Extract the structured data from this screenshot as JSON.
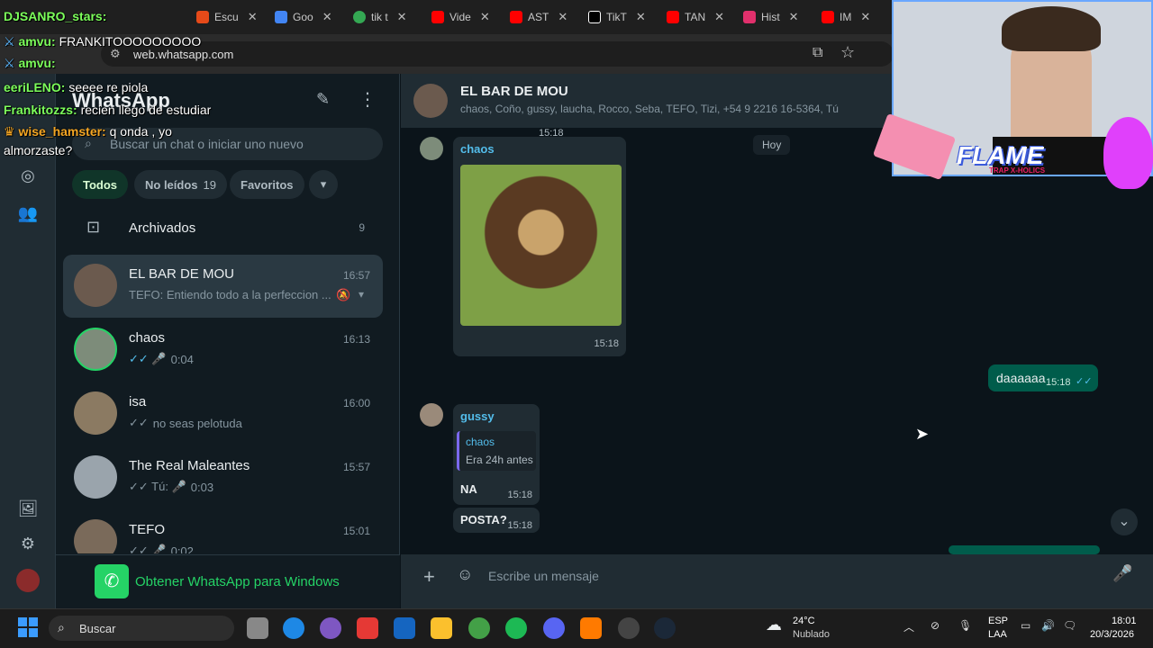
{
  "browser": {
    "tabs": [
      {
        "label": "Escu",
        "color": "#e64a19"
      },
      {
        "label": "Goo",
        "color": "#4285f4"
      },
      {
        "label": "tik t",
        "color": "#34a853"
      },
      {
        "label": "Vide",
        "color": "#ff0000"
      },
      {
        "label": "AST",
        "color": "#ff0000"
      },
      {
        "label": "TikT",
        "color": "#ffffff"
      },
      {
        "label": "TAN",
        "color": "#ff0000"
      },
      {
        "label": "Hist",
        "color": "#e1306c"
      },
      {
        "label": "IM",
        "color": "#ff0000"
      }
    ],
    "url": "web.whatsapp.com"
  },
  "stream_chat": [
    {
      "user": "DJSANRO_stars:",
      "text": "",
      "color": "#7cff5b"
    },
    {
      "user": "amvu:",
      "text": "FRANKITOOOOOOOOO",
      "color": "#7cff5b"
    },
    {
      "user": "amvu:",
      "text": "",
      "color": "#7cff5b"
    },
    {
      "user": "eeriLENO:",
      "text": "seeee re piola",
      "color": "#7cff5b"
    },
    {
      "user": "Frankitozzs:",
      "text": "recien llego de estudiar",
      "color": "#7cff5b"
    },
    {
      "user": "wise_hamster:",
      "text": "q onda , yo",
      "color": "#f5a623"
    },
    {
      "user": "",
      "text": "almorzaste?",
      "color": "#ffffff"
    }
  ],
  "whatsapp": {
    "title": "WhatsApp",
    "search_placeholder": "Buscar un chat o iniciar uno nuevo",
    "filters": {
      "all": "Todos",
      "unread": "No leídos",
      "unread_count": "19",
      "favorites": "Favoritos"
    },
    "archived": {
      "label": "Archivados",
      "count": "9"
    },
    "chats": [
      {
        "name": "EL BAR DE MOU",
        "time": "16:57",
        "last": "TEFO: Entiendo todo a la perfeccion ...",
        "icon": "",
        "avatar": "#6b5a4e"
      },
      {
        "name": "chaos",
        "time": "16:13",
        "last": "0:04",
        "icon": "✓✓ 🎤",
        "avatar": "#7d8c7a"
      },
      {
        "name": "isa",
        "time": "16:00",
        "last": "no seas pelotuda",
        "icon": "✓✓",
        "avatar": "#8b7a62"
      },
      {
        "name": "The Real Maleantes",
        "time": "15:57",
        "last": "0:03",
        "icon": "✓✓ Tú: 🎤",
        "avatar": "#9aa4ac"
      },
      {
        "name": "TEFO",
        "time": "15:01",
        "last": "0:02",
        "icon": "✓✓ 🎤",
        "avatar": "#7a6a5a"
      }
    ],
    "get_windows": "Obtener WhatsApp para Windows",
    "conversation": {
      "name": "EL BAR DE MOU",
      "members": "chaos, Coño, gussy, laucha, Rocco, Seba, TEFO, Tizi, +54 9 2216 16-5364, Tú",
      "date_badge": "Hoy",
      "top_time": "15:18",
      "messages": {
        "m1_sender": "chaos",
        "m1_time": "15:18",
        "m2_text": "daaaaaa",
        "m2_time": "15:18",
        "m3_sender": "gussy",
        "m3_quote_sender": "chaos",
        "m3_quote_text": "Era 24h antes",
        "m3_text": "NA",
        "m3_time": "15:18",
        "m4_text": "POSTA?",
        "m4_time": "15:18"
      },
      "composer_placeholder": "Escribe un mensaje"
    }
  },
  "overlay": {
    "logo_text": "FLAME",
    "logo_sub": "TRAP X-HOLICS"
  },
  "taskbar": {
    "search": "Buscar",
    "weather_temp": "24°C",
    "weather_desc": "Nublado",
    "lang": "ESP",
    "layout": "LAA",
    "time": "18:01",
    "date": "20/3/2026"
  }
}
